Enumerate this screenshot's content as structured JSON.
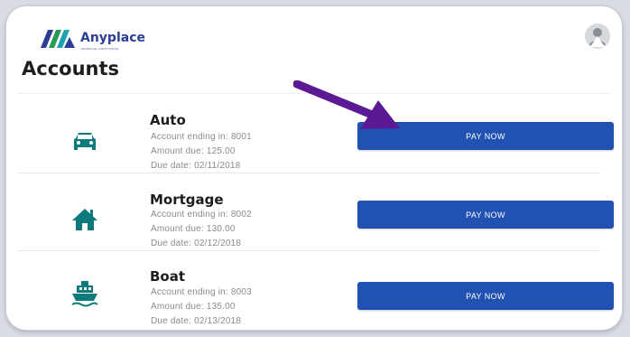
{
  "brand": {
    "name": "Anyplace",
    "tagline": "FINANCIAL INSTITUTION",
    "colors": {
      "navy": "#2a3f95",
      "green": "#2a9a5a",
      "teal": "#12a0a0"
    }
  },
  "header": {
    "user_icon": "user-avatar-icon"
  },
  "page": {
    "title": "Accounts"
  },
  "accounts": [
    {
      "name": "Auto",
      "icon": "car-icon",
      "account_line": "Account ending in: 8001",
      "amount_line": "Amount due: 125.00",
      "due_line": "Due date: 02/11/2018",
      "action_label": "PAY NOW"
    },
    {
      "name": "Mortgage",
      "icon": "house-icon",
      "account_line": "Account ending in: 8002",
      "amount_line": "Amount due: 130.00",
      "due_line": "Due date: 02/12/2018",
      "action_label": "PAY NOW"
    },
    {
      "name": "Boat",
      "icon": "boat-icon",
      "account_line": "Account ending in: 8003",
      "amount_line": "Amount due: 135.00",
      "due_line": "Due date: 02/13/2018",
      "action_label": "PAY NOW"
    }
  ],
  "annotation": {
    "icon": "arrow-pointer-icon",
    "color": "#5b1a93"
  },
  "colors": {
    "button": "#2151b1",
    "icon": "#0f7a7c",
    "background": "#ffffff"
  }
}
